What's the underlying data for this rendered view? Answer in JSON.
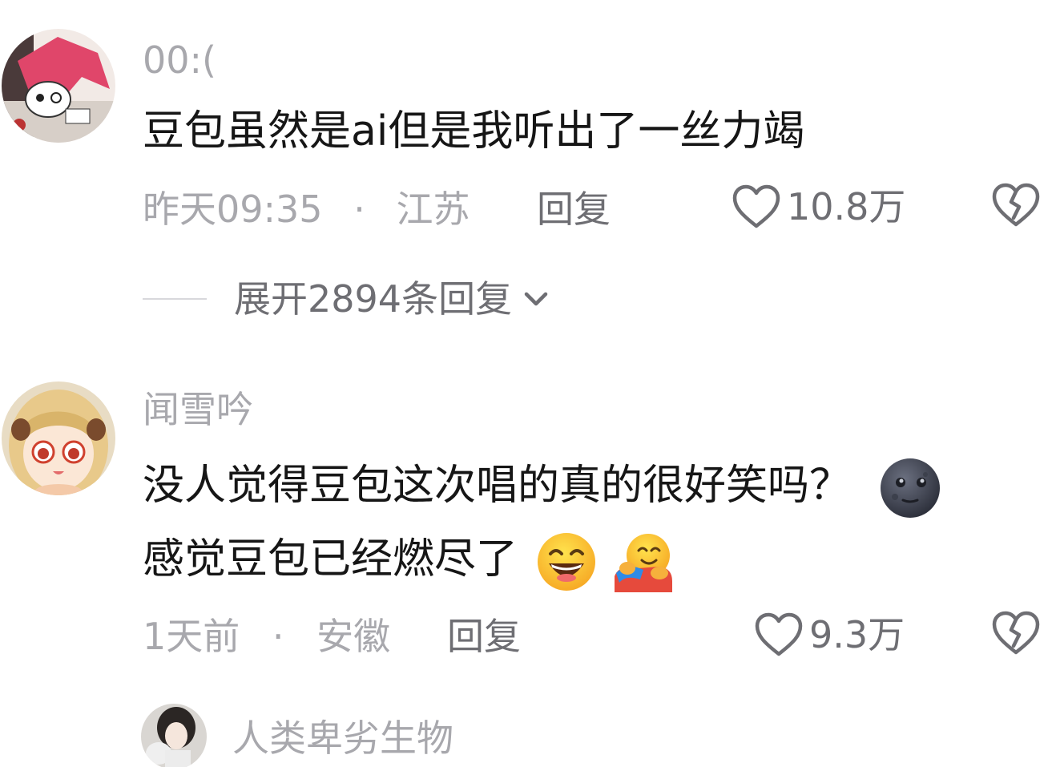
{
  "comments": [
    {
      "username": "00:(",
      "text_lines": [
        "豆包虽然是ai但是我听出了一丝力竭"
      ],
      "timestamp": "昨天09:35",
      "separator": "·",
      "location": "江苏",
      "reply_label": "回复",
      "likes": "10.8万",
      "expand_label": "展开2894条回复"
    },
    {
      "username": "闻雪吟",
      "text_lines": [
        "没人觉得豆包这次唱的真的很好笑吗？",
        "感觉豆包已经燃尽了"
      ],
      "emoji_line1": [
        "new-moon-face"
      ],
      "emoji_line2": [
        "grinning-squinting-face",
        "hugging-face"
      ],
      "timestamp": "1天前",
      "separator": "·",
      "location": "安徽",
      "reply_label": "回复",
      "likes": "9.3万"
    },
    {
      "username": "人类卑劣生物"
    }
  ],
  "colors": {
    "meta_gray": "#a8a8ad",
    "action_gray": "#6e6e73",
    "text": "#161616",
    "background": "#ffffff"
  }
}
